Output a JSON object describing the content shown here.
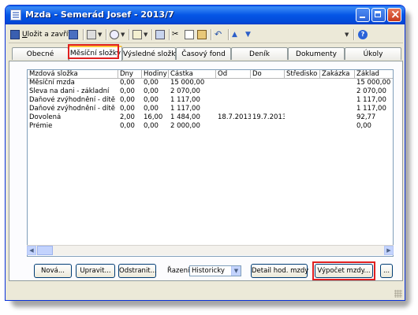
{
  "window": {
    "title": "Mzda - Semerád Josef - 2013/7"
  },
  "toolbar": {
    "save_close": "Uložit a zavřít"
  },
  "tabs": [
    {
      "label": "Obecné"
    },
    {
      "label": "Měsíční složky"
    },
    {
      "label": "Výsledné složky"
    },
    {
      "label": "Časový fond"
    },
    {
      "label": "Deník"
    },
    {
      "label": "Dokumenty"
    },
    {
      "label": "Úkoly"
    }
  ],
  "grid": {
    "columns": [
      "Mzdová složka",
      "Dny",
      "Hodiny",
      "Částka",
      "Od",
      "Do",
      "Středisko",
      "Zakázka",
      "Základ"
    ],
    "rows": [
      [
        "Měsíční mzda",
        "0,00",
        "0,00",
        "15 000,00",
        "",
        "",
        "",
        "",
        "15 000,00"
      ],
      [
        "Sleva na dani - základní",
        "0,00",
        "0,00",
        "2 070,00",
        "",
        "",
        "",
        "",
        "2 070,00"
      ],
      [
        "Daňové zvýhodnění - dítě",
        "0,00",
        "0,00",
        "1 117,00",
        "",
        "",
        "",
        "",
        "1 117,00"
      ],
      [
        "Daňové zvýhodnění - dítě",
        "0,00",
        "0,00",
        "1 117,00",
        "",
        "",
        "",
        "",
        "1 117,00"
      ],
      [
        "Dovolená",
        "2,00",
        "16,00",
        "1 484,00",
        "18.7.2013",
        "19.7.2013",
        "",
        "",
        "92,77"
      ],
      [
        "Prémie",
        "0,00",
        "0,00",
        "2 000,00",
        "",
        "",
        "",
        "",
        "0,00"
      ]
    ]
  },
  "buttons": {
    "new": "Nová...",
    "edit": "Upravit...",
    "delete": "Odstranit...",
    "sort_label": "Řazení",
    "sort_value": "Historicky",
    "detail": "Detail hod. mzdy",
    "calc": "Výpočet mzdy...",
    "more": "..."
  },
  "colors": {
    "highlight": "#e02020",
    "titlebar": "#0556e6"
  }
}
